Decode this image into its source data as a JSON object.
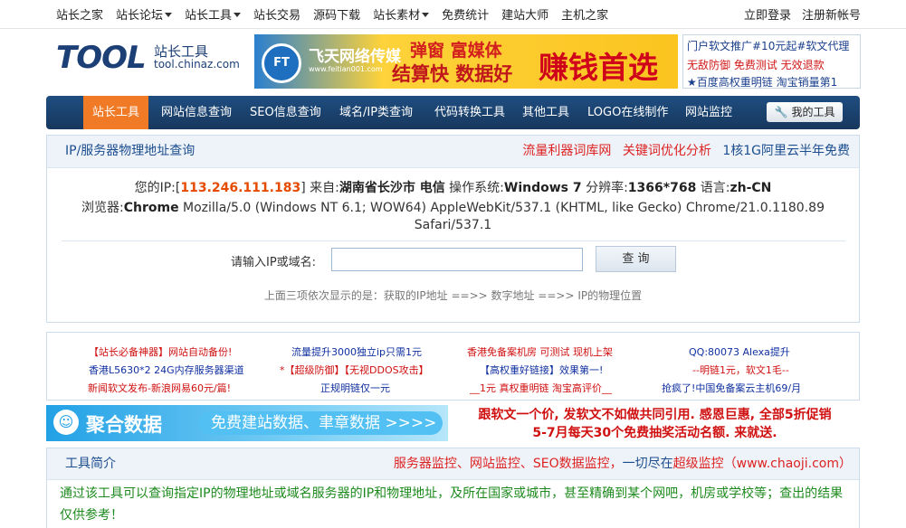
{
  "topbar": {
    "items": [
      {
        "label": "站长之家",
        "caret": false
      },
      {
        "label": "站长论坛",
        "caret": true
      },
      {
        "label": "站长工具",
        "caret": true
      },
      {
        "label": "站长交易",
        "caret": false
      },
      {
        "label": "源码下载",
        "caret": false
      },
      {
        "label": "站长素材",
        "caret": true
      },
      {
        "label": "免费统计",
        "caret": false
      },
      {
        "label": "建站大师",
        "caret": false
      },
      {
        "label": "主机之家",
        "caret": false
      }
    ],
    "login": "立即登录",
    "register": "注册新帐号"
  },
  "logo": {
    "word": "TOOL",
    "cn": "站长工具",
    "url": "tool.chinaz.com"
  },
  "banner_ad": {
    "badge": "FT",
    "brand": "飞天网络传媒",
    "brand_url": "www.feitian001.com",
    "line1": "弹窗 富媒体",
    "line2": "结算快 数据好",
    "slogan": "赚钱首选"
  },
  "side_ad": {
    "line1": "门户软文推广#10元起#软文代理",
    "line2": "无敌防御 免费测试 无效退款",
    "line3": "★百度高权重明链 淘宝销量第1"
  },
  "mainnav": {
    "items": [
      "站长工具",
      "网站信息查询",
      "SEO信息查询",
      "域名/IP类查询",
      "代码转换工具",
      "其他工具",
      "LOGO在线制作",
      "网站监控"
    ],
    "my_tools": "我的工具"
  },
  "query": {
    "title": "IP/服务器物理地址查询",
    "links": [
      "流量利器词库网",
      "关键词优化分析",
      "1核1G阿里云半年免费"
    ],
    "ip_label": "您的IP:[",
    "ip": "113.246.111.183",
    "from_label": "] 来自:",
    "location": "湖南省长沙市 电信",
    "os_label": " 操作系统:",
    "os": "Windows 7",
    "res_label": " 分辨率:",
    "resolution": "1366*768",
    "lang_label": " 语言:",
    "lang": "zh-CN",
    "browser_label": "浏览器:",
    "browser": "Chrome",
    "ua_1": " Mozilla/5.0 (Windows NT 6.1; WOW64) AppleWebKit/537.1 (KHTML, like Gecko) Chrome/21.0.1180.89",
    "ua_2": "Safari/537.1",
    "input_label": "请输入IP或域名:",
    "input_value": "",
    "button": "查 询",
    "hint": "上面三项依次显示的是：获取的IP地址 ==>> 数字地址 ==>> IP的物理位置"
  },
  "ads_grid": [
    [
      "【站长必备神器】网站自动备份!",
      "流量提升3000独立ip只需1元",
      "香港免备案机房 可测试 现机上架",
      "QQ:80073 Alexa提升"
    ],
    [
      "香港L5630*2 24G内存服务器渠道",
      "*【超级防御】【无视DDOS攻击】",
      "【高权重好链接】效果第一!",
      "--明链1元，软文1毛--"
    ],
    [
      "新闻软文发布-新浪网易60元/篇!",
      "正规明链仅一元",
      "__1元 真权重明链 淘宝高评价__",
      "抢疯了!中国免备案云主机69/月"
    ]
  ],
  "data_banner": {
    "face": "☺",
    "brand": "聚合数据",
    "pill": "免费建站数据、聿章数据 >>>>"
  },
  "promo": {
    "line1": "跟软文一个价, 发软文不如做共同引用. 感恩巨惠, 全部5折促销",
    "line2": "5-7月每天30个免费抽奖活动名额. 来就送."
  },
  "intro": {
    "title": "工具简介",
    "links_pre": "服务器监控、网站监控、SEO数据监控，",
    "links_mid": "一切尽在",
    "links_brand": "超级监控",
    "links_url": "（www.chaoji.com）",
    "text": "通过该工具可以查询指定IP的物理地址或域名服务器的IP和物理地址，及所在国家或城市，甚至精确到某个网吧，机房或学校等；查出的结果仅供参考！"
  },
  "colors": {
    "nav_bg": "#1f4d80",
    "nav_active": "#f07a25",
    "ip_highlight": "#e64a00",
    "intro_text": "#1d8a1d"
  }
}
